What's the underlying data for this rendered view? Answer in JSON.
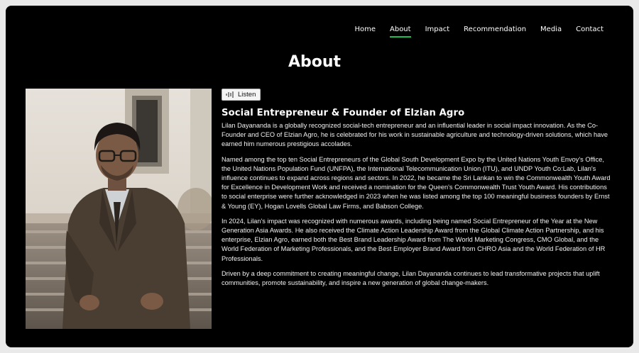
{
  "nav": {
    "items": [
      "Home",
      "About",
      "Impact",
      "Recommendation",
      "Media",
      "Contact"
    ],
    "active": "About",
    "accent": "#1fbf4f"
  },
  "page": {
    "title": "About"
  },
  "profile": {
    "listen_label": "Listen",
    "heading": "Social Entrepreneur & Founder of Elzian Agro",
    "paragraphs": [
      "Lilan Dayananda is a globally recognized social-tech entrepreneur and an influential leader in social impact innovation. As the Co-Founder and CEO of Elzian Agro, he is celebrated for his work in sustainable agriculture and technology-driven solutions, which have earned him numerous prestigious accolades.",
      "Named among the top ten Social Entrepreneurs of the Global South Development Expo by the United Nations Youth Envoy's Office, the United Nations Population Fund (UNFPA), the International Telecommunication Union (ITU), and UNDP Youth Co:Lab, Lilan's influence continues to expand across regions and sectors. In 2022, he became the Sri Lankan to win the Commonwealth Youth Award for Excellence in Development Work and received a nomination for the Queen's Commonwealth Trust Youth Award. His contributions to social enterprise were further acknowledged in 2023 when he was listed among the top 100 meaningful business founders by Ernst & Young (EY), Hogan Lovells Global Law Firms, and Babson College.",
      "In 2024, Lilan's impact was recognized with numerous awards, including being named Social Entrepreneur of the Year at the New Generation Asia Awards. He also received the Climate Action Leadership Award from the Global Climate Action Partnership, and his enterprise, Elzian Agro, earned both the Best Brand Leadership Award from The World Marketing Congress, CMO Global, and the World Federation of Marketing Professionals, and the Best Employer Brand Award from CHRO Asia and the World Federation of HR Professionals.",
      "Driven by a deep commitment to creating meaningful change, Lilan Dayananda continues to lead transformative projects that uplift communities, promote sustainability, and inspire a new generation of global change-makers."
    ]
  }
}
